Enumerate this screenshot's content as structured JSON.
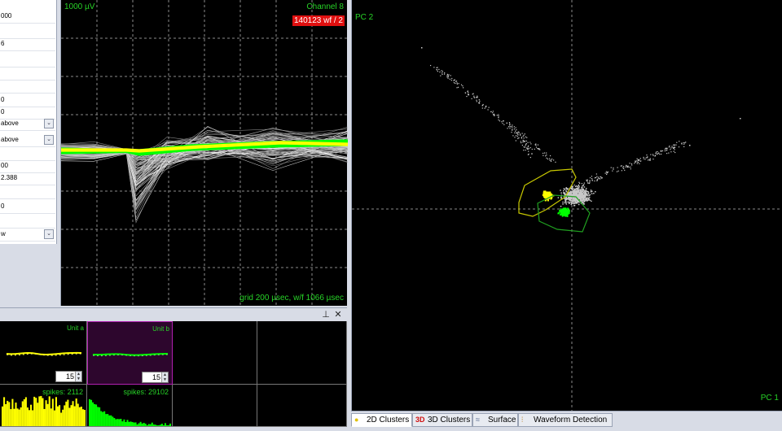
{
  "properties": {
    "values": [
      "000",
      "",
      "6",
      "",
      "",
      "",
      "0",
      "0",
      "above",
      "above",
      "",
      "00",
      "2.388",
      "",
      "0",
      "",
      "w"
    ]
  },
  "waveform": {
    "scale_label": "1000 µV",
    "channel_label": "Channel 8",
    "wf_badge": "140123 wf / 2",
    "grid_label": "grid 200 µsec, w/f 1066 µsec"
  },
  "units_dock": {
    "pin_icon": "pin-icon",
    "close_label": "✕",
    "units": [
      {
        "name": "Unit a",
        "spin_value": "15",
        "spikes_label": "spikes: 2112",
        "color": "#ffff00"
      },
      {
        "name": "Unit b",
        "spin_value": "15",
        "spikes_label": "spikes: 29102",
        "color": "#00ff00"
      }
    ]
  },
  "clusters": {
    "x_axis_label": "PC 1",
    "y_axis_label": "PC 2",
    "colors": {
      "unit_a": "#ffff00",
      "unit_b": "#00ff00",
      "unsorted": "#c8c8c8"
    }
  },
  "tabs": [
    {
      "label": "2D Clusters",
      "icon": "2d-clusters-icon",
      "active": true
    },
    {
      "label": "3D Clusters",
      "icon": "3d-clusters-icon",
      "active": false
    },
    {
      "label": "Surface",
      "icon": "surface-icon",
      "active": false
    },
    {
      "label": "Waveform Detection",
      "icon": "waveform-detection-icon",
      "active": false
    }
  ]
}
